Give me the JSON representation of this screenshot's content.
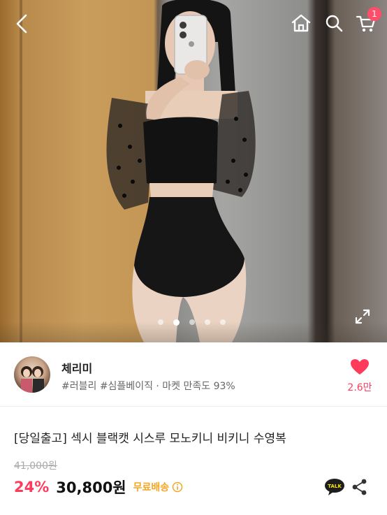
{
  "header": {
    "cart_count": "1",
    "icons": [
      "chevron-left-icon",
      "home-icon",
      "search-icon",
      "cart-icon"
    ]
  },
  "carousel": {
    "total_slides": 5,
    "active_index": 1
  },
  "seller": {
    "name": "체리미",
    "tags": "#러블리 #심플베이직 · 마켓 만족도 93%",
    "likes": "2.6만"
  },
  "product": {
    "title": "[당일출고] 섹시 블랙캣 시스루 모노키니 비키니 수영복",
    "original_price": "41,000원",
    "discount": "24%",
    "price": "30,800원",
    "shipping": "무료배송"
  },
  "colors": {
    "accent": "#ff3b5c",
    "shipping": "#f5a623",
    "badge": "#ff4d6a"
  }
}
